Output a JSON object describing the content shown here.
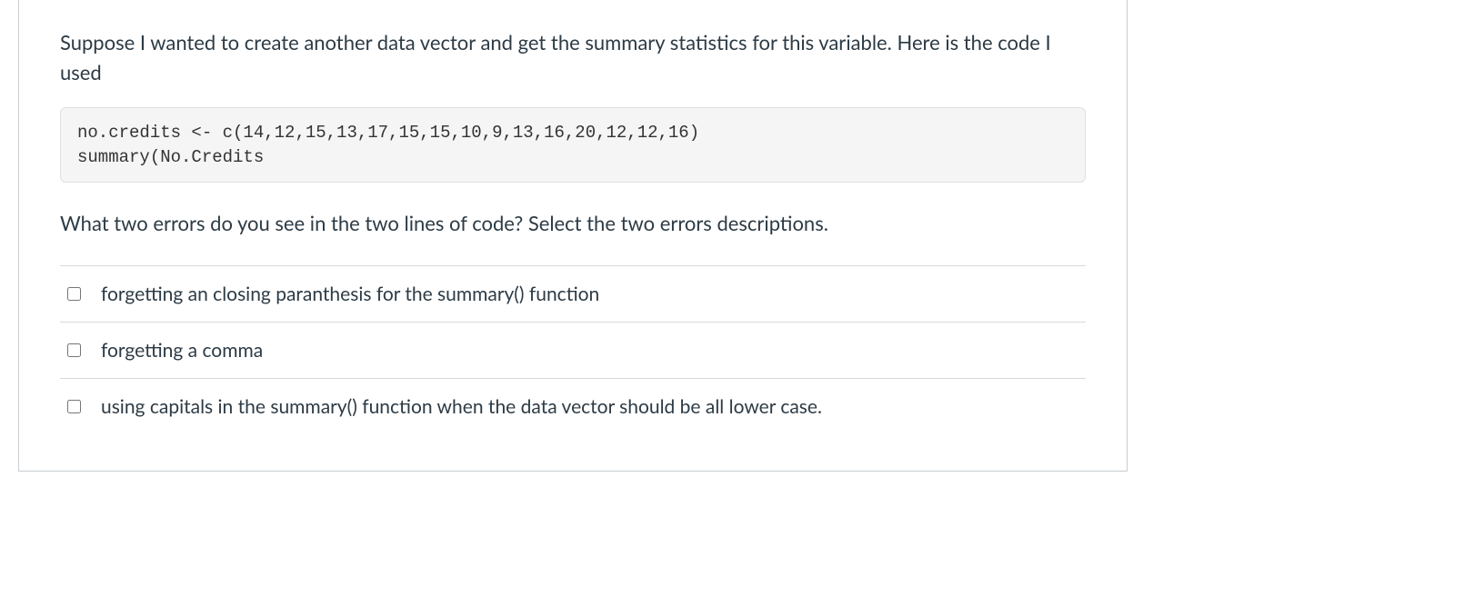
{
  "question": {
    "intro": "Suppose I wanted to create another data vector and get the summary statistics for this variable. Here is the code I used",
    "code": "no.credits <- c(14,12,15,13,17,15,15,10,9,13,16,20,12,12,16)\nsummary(No.Credits",
    "prompt": "What two errors do you see in the two lines of code? Select the two errors descriptions."
  },
  "answers": [
    {
      "label": "forgetting an closing paranthesis for the summary() function"
    },
    {
      "label": "forgetting a comma"
    },
    {
      "label": "using capitals in the summary() function when the data vector should be all lower case."
    }
  ]
}
